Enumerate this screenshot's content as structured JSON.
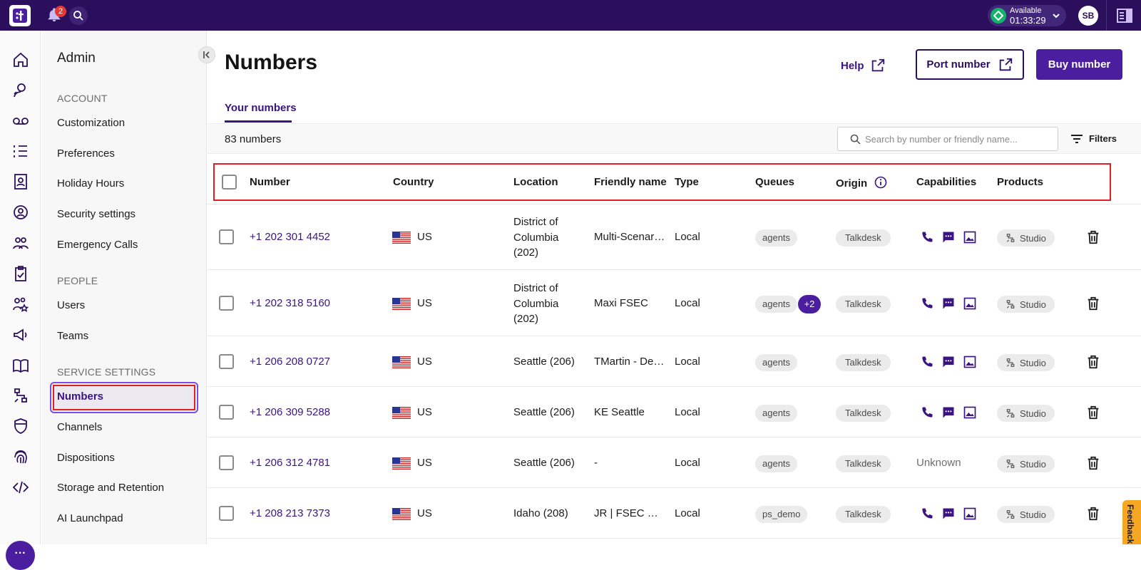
{
  "topbar": {
    "logo_text": "t",
    "notifications_count": "2",
    "status": {
      "label": "Available",
      "time": "01:33:29",
      "color": "#14b36a"
    },
    "avatar_initials": "SB"
  },
  "rail": {
    "icons": [
      "home-icon",
      "agent-icon",
      "voicemail-icon",
      "list-icon",
      "contacts-icon",
      "live-icon",
      "team-icon",
      "clipboard-icon",
      "users-star-icon",
      "megaphone-icon",
      "book-icon",
      "studio-icon",
      "shield-icon",
      "fingerprint-icon",
      "code-icon"
    ],
    "more_label": "···"
  },
  "sidebar": {
    "title": "Admin",
    "sections": [
      {
        "heading": "ACCOUNT",
        "items": [
          "Customization",
          "Preferences",
          "Holiday Hours",
          "Security settings",
          "Emergency Calls"
        ]
      },
      {
        "heading": "PEOPLE",
        "items": [
          "Users",
          "Teams"
        ]
      },
      {
        "heading": "SERVICE SETTINGS",
        "items": [
          "Numbers",
          "Channels",
          "Dispositions",
          "Storage and Retention",
          "AI Launchpad"
        ]
      }
    ],
    "active_item": "Numbers"
  },
  "main": {
    "title": "Numbers",
    "help_label": "Help",
    "port_label": "Port number",
    "buy_label": "Buy number",
    "tab_label": "Your numbers",
    "count_label": "83 numbers",
    "search_placeholder": "Search by number or friendly name...",
    "filters_label": "Filters",
    "columns": [
      "Number",
      "Country",
      "Location",
      "Friendly name",
      "Type",
      "Queues",
      "Origin",
      "Capabilities",
      "Products"
    ],
    "rows": [
      {
        "number": "+1 202 301 4452",
        "country": "US",
        "location": "District of Columbia (202)",
        "friendly_name": "Multi-Scenar…",
        "type": "Local",
        "queue": "agents",
        "queue_extra": "",
        "origin": "Talkdesk",
        "capabilities": "voice sms mms",
        "product": "Studio"
      },
      {
        "number": "+1 202 318 5160",
        "country": "US",
        "location": "District of Columbia (202)",
        "friendly_name": "Maxi FSEC",
        "type": "Local",
        "queue": "agents",
        "queue_extra": "+2",
        "origin": "Talkdesk",
        "capabilities": "voice sms mms",
        "product": "Studio"
      },
      {
        "number": "+1 206 208 0727",
        "country": "US",
        "location": "Seattle (206)",
        "friendly_name": "TMartin - De…",
        "type": "Local",
        "queue": "agents",
        "queue_extra": "",
        "origin": "Talkdesk",
        "capabilities": "voice sms mms",
        "product": "Studio"
      },
      {
        "number": "+1 206 309 5288",
        "country": "US",
        "location": "Seattle (206)",
        "friendly_name": "KE Seattle",
        "type": "Local",
        "queue": "agents",
        "queue_extra": "",
        "origin": "Talkdesk",
        "capabilities": "voice sms mms",
        "product": "Studio"
      },
      {
        "number": "+1 206 312 4781",
        "country": "US",
        "location": "Seattle (206)",
        "friendly_name": "-",
        "type": "Local",
        "queue": "agents",
        "queue_extra": "",
        "origin": "Talkdesk",
        "capabilities": "Unknown",
        "product": "Studio"
      },
      {
        "number": "+1 208 213 7373",
        "country": "US",
        "location": "Idaho (208)",
        "friendly_name": "JR | FSEC De…",
        "type": "Local",
        "queue": "ps_demo",
        "queue_extra": "",
        "origin": "Talkdesk",
        "capabilities": "voice sms mms",
        "product": "Studio"
      }
    ]
  },
  "feedback_label": "Feedback",
  "colors": {
    "brand_dark": "#2c0f5c",
    "brand": "#4b1ea0",
    "link": "#3a1480",
    "highlight": "#e02020"
  }
}
